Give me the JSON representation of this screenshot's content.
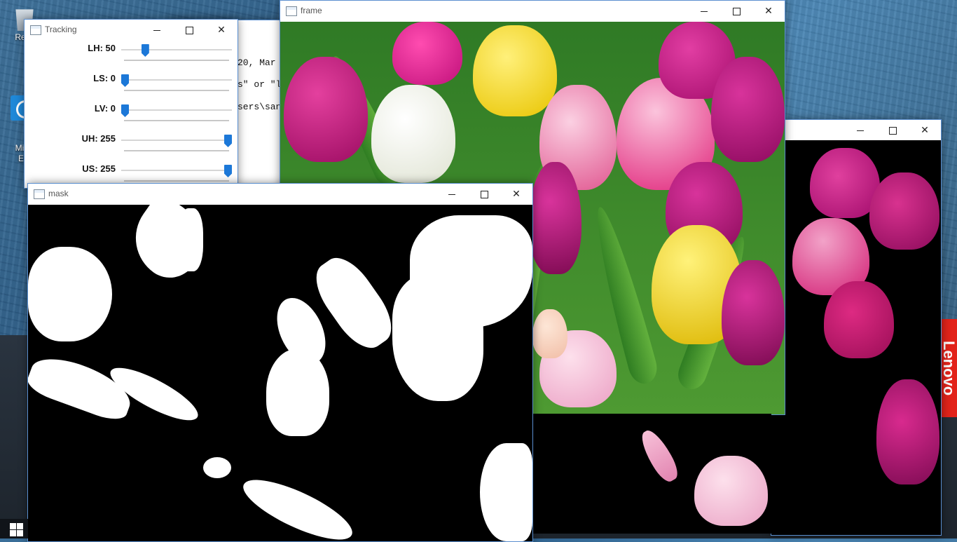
{
  "desktop": {
    "icons": [
      {
        "label": "Recy",
        "icon": "recycle-bin-icon"
      },
      {
        "label": "Micr\nEc",
        "icon": "edge-icon"
      }
    ],
    "brand_badge": "Lenovo"
  },
  "console": {
    "lines": [
      "20, Mar",
      "s\" or \"l",
      "sers\\san"
    ]
  },
  "tracking": {
    "title": "Tracking",
    "trackbars": [
      {
        "label": "LH: 50",
        "value": 50,
        "max": 255
      },
      {
        "label": "LS: 0",
        "value": 0,
        "max": 255
      },
      {
        "label": "LV: 0",
        "value": 0,
        "max": 255
      },
      {
        "label": "UH: 255",
        "value": 255,
        "max": 255
      },
      {
        "label": "US: 255",
        "value": 255,
        "max": 255
      }
    ]
  },
  "frame": {
    "title": "frame"
  },
  "mask": {
    "title": "mask"
  },
  "result": {
    "title": ""
  },
  "window_controls": {
    "minimize": "minimize",
    "maximize": "maximize",
    "close": "close"
  }
}
